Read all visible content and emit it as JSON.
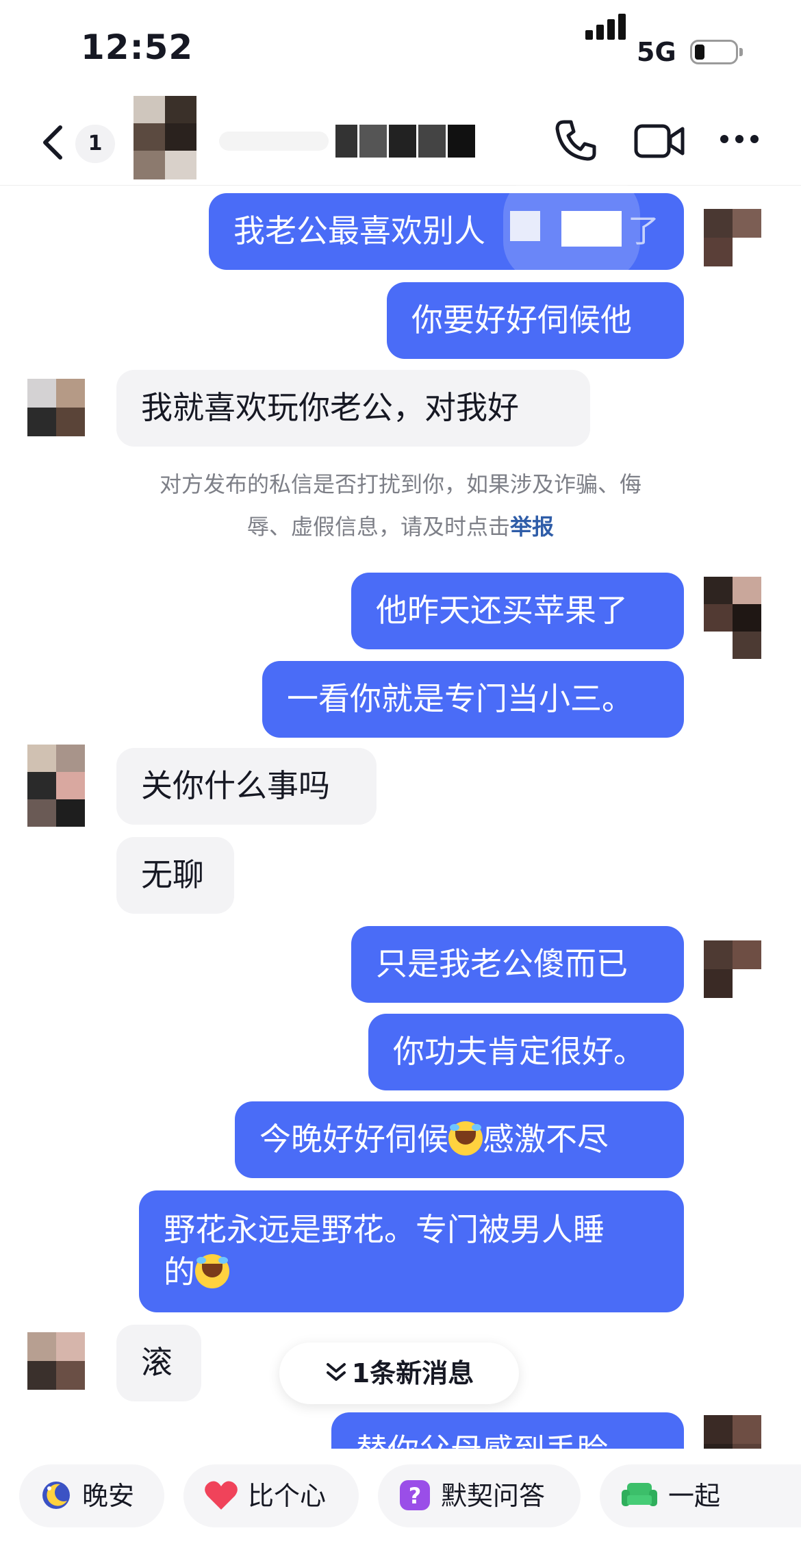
{
  "status_bar": {
    "time": "12:52",
    "network": "5G"
  },
  "header": {
    "unread_count": "1"
  },
  "messages": [
    {
      "side": "right",
      "text": "我老公最喜欢别人"
    },
    {
      "side": "right",
      "text": "你要好好伺候他"
    },
    {
      "side": "left",
      "text": "我就喜欢玩你老公，对我好"
    },
    {
      "side": "right",
      "text": "他昨天还买苹果了"
    },
    {
      "side": "right",
      "text": "一看你就是专门当小三。"
    },
    {
      "side": "left",
      "text": "关你什么事吗"
    },
    {
      "side": "left",
      "text": "无聊"
    },
    {
      "side": "right",
      "text": "只是我老公傻而已"
    },
    {
      "side": "right",
      "text": "你功夫肯定很好。"
    },
    {
      "side": "right",
      "text_before": "今晚好好伺候",
      "text_after": "感激不尽"
    },
    {
      "side": "right",
      "line1": "野花永远是野花。专门被男人睡",
      "line2": "的"
    },
    {
      "side": "left",
      "text": "滚"
    },
    {
      "side": "right",
      "text": "替你父母感到丢脸"
    }
  ],
  "notice": {
    "line1": "对方发布的私信是否打扰到你，如果涉及诈骗、侮",
    "line2": "辱、虚假信息，请及时点击",
    "report_link": "举报"
  },
  "new_messages_pill": "1条新消息",
  "quick_replies": [
    {
      "label": "晚安",
      "icon": "moon-icon"
    },
    {
      "label": "比个心",
      "icon": "heart-icon"
    },
    {
      "label": "默契问答",
      "icon": "question-icon"
    },
    {
      "label": "一起",
      "icon": "sofa-icon"
    }
  ],
  "colors": {
    "sent_bubble": "#4a6cf7",
    "received_bubble": "#f3f3f5",
    "report_link": "#2f5da8"
  }
}
